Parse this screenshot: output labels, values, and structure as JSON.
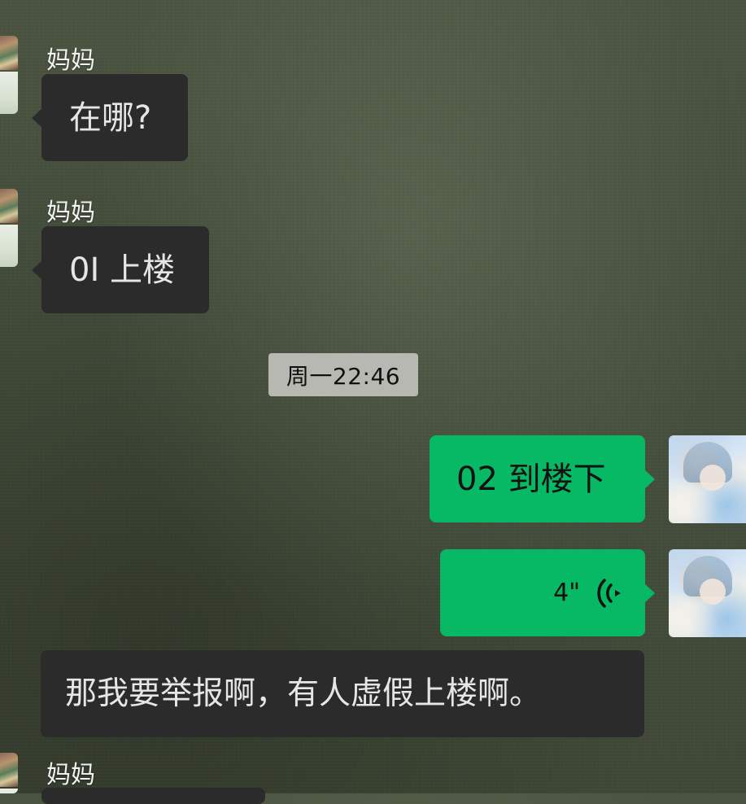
{
  "chat": {
    "timestamp": "周一22:46",
    "messages": [
      {
        "sender": "妈妈",
        "text": "在哪?"
      },
      {
        "sender": "妈妈",
        "text": "0I 上楼"
      },
      {
        "sender": "me",
        "text": "02 到楼下"
      },
      {
        "sender": "me",
        "voice_duration": "4\""
      },
      {
        "sender": "other",
        "text": "那我要举报啊，有人虚假上楼啊。"
      },
      {
        "sender": "妈妈"
      }
    ]
  },
  "icons": {
    "voice": "voice-wave-icon",
    "avatar_mom": "avatar",
    "avatar_me": "avatar"
  },
  "colors": {
    "incoming_bubble": "#2b2b2b",
    "outgoing_bubble": "#07b864",
    "timestamp_bg": "#b8b8b3"
  }
}
